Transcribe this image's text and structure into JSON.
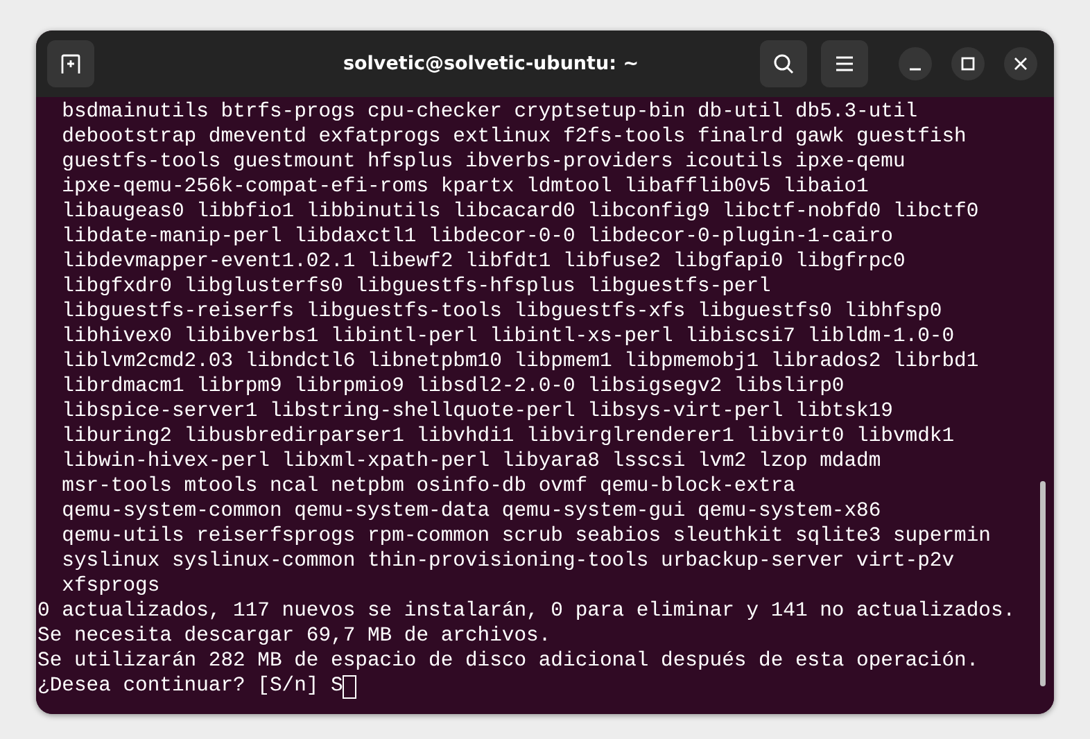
{
  "window": {
    "title": "solvetic@solvetic-ubuntu: ~"
  },
  "terminal": {
    "lines": [
      {
        "kind": "package",
        "text": "bsdmainutils btrfs-progs cpu-checker cryptsetup-bin db-util db5.3-util"
      },
      {
        "kind": "package",
        "text": "debootstrap dmeventd exfatprogs extlinux f2fs-tools finalrd gawk guestfish"
      },
      {
        "kind": "package",
        "text": "guestfs-tools guestmount hfsplus ibverbs-providers icoutils ipxe-qemu"
      },
      {
        "kind": "package",
        "text": "ipxe-qemu-256k-compat-efi-roms kpartx ldmtool libafflib0v5 libaio1"
      },
      {
        "kind": "package",
        "text": "libaugeas0 libbfio1 libbinutils libcacard0 libconfig9 libctf-nobfd0 libctf0"
      },
      {
        "kind": "package",
        "text": "libdate-manip-perl libdaxctl1 libdecor-0-0 libdecor-0-plugin-1-cairo"
      },
      {
        "kind": "package",
        "text": "libdevmapper-event1.02.1 libewf2 libfdt1 libfuse2 libgfapi0 libgfrpc0"
      },
      {
        "kind": "package",
        "text": "libgfxdr0 libglusterfs0 libguestfs-hfsplus libguestfs-perl"
      },
      {
        "kind": "package",
        "text": "libguestfs-reiserfs libguestfs-tools libguestfs-xfs libguestfs0 libhfsp0"
      },
      {
        "kind": "package",
        "text": "libhivex0 libibverbs1 libintl-perl libintl-xs-perl libiscsi7 libldm-1.0-0"
      },
      {
        "kind": "package",
        "text": "liblvm2cmd2.03 libndctl6 libnetpbm10 libpmem1 libpmemobj1 librados2 librbd1"
      },
      {
        "kind": "package",
        "text": "librdmacm1 librpm9 librpmio9 libsdl2-2.0-0 libsigsegv2 libslirp0"
      },
      {
        "kind": "package",
        "text": "libspice-server1 libstring-shellquote-perl libsys-virt-perl libtsk19"
      },
      {
        "kind": "package",
        "text": "liburing2 libusbredirparser1 libvhdi1 libvirglrenderer1 libvirt0 libvmdk1"
      },
      {
        "kind": "package",
        "text": "libwin-hivex-perl libxml-xpath-perl libyara8 lsscsi lvm2 lzop mdadm"
      },
      {
        "kind": "package",
        "text": "msr-tools mtools ncal netpbm osinfo-db ovmf qemu-block-extra"
      },
      {
        "kind": "package",
        "text": "qemu-system-common qemu-system-data qemu-system-gui qemu-system-x86"
      },
      {
        "kind": "package",
        "text": "qemu-utils reiserfsprogs rpm-common scrub seabios sleuthkit sqlite3 supermin"
      },
      {
        "kind": "package",
        "text": "syslinux syslinux-common thin-provisioning-tools urbackup-server virt-p2v"
      },
      {
        "kind": "package",
        "text": "xfsprogs"
      },
      {
        "kind": "output",
        "text": "0 actualizados, 117 nuevos se instalarán, 0 para eliminar y 141 no actualizados."
      },
      {
        "kind": "output",
        "text": "Se necesita descargar 69,7 MB de archivos."
      },
      {
        "kind": "output",
        "text": "Se utilizarán 282 MB de espacio de disco adicional después de esta operación."
      },
      {
        "kind": "prompt",
        "text": "¿Desea continuar? [S/n] S",
        "cursor": true
      }
    ]
  }
}
